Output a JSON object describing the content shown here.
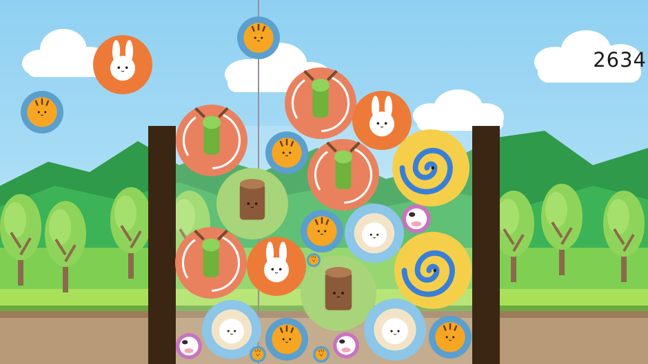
{
  "hud": {
    "score": "2634"
  },
  "palette": {
    "rabbit": "#ee7a38",
    "tiger": "#5b9fce",
    "deer": "#e9815f",
    "stump": "#a8d47a",
    "snake": "#f6cf4a",
    "sheep": "#8cc6e8",
    "cow": "#c973c0",
    "box_wall": "#3a2613"
  },
  "play_area": {
    "drop_guide": "vertical-guide-line",
    "container": "wooden-box",
    "next_ball": "tiger"
  },
  "balls_in_box": [
    "deer",
    "deer",
    "rabbit",
    "tiger",
    "snake",
    "deer",
    "stump",
    "cow",
    "tiger",
    "sheep",
    "deer",
    "rabbit",
    "snake",
    "stump",
    "sheep",
    "sheep",
    "tiger",
    "cow",
    "cow",
    "tiger",
    "tiger",
    "rabbit",
    "tiger"
  ],
  "balls_outside": [
    "rabbit",
    "tiger"
  ]
}
